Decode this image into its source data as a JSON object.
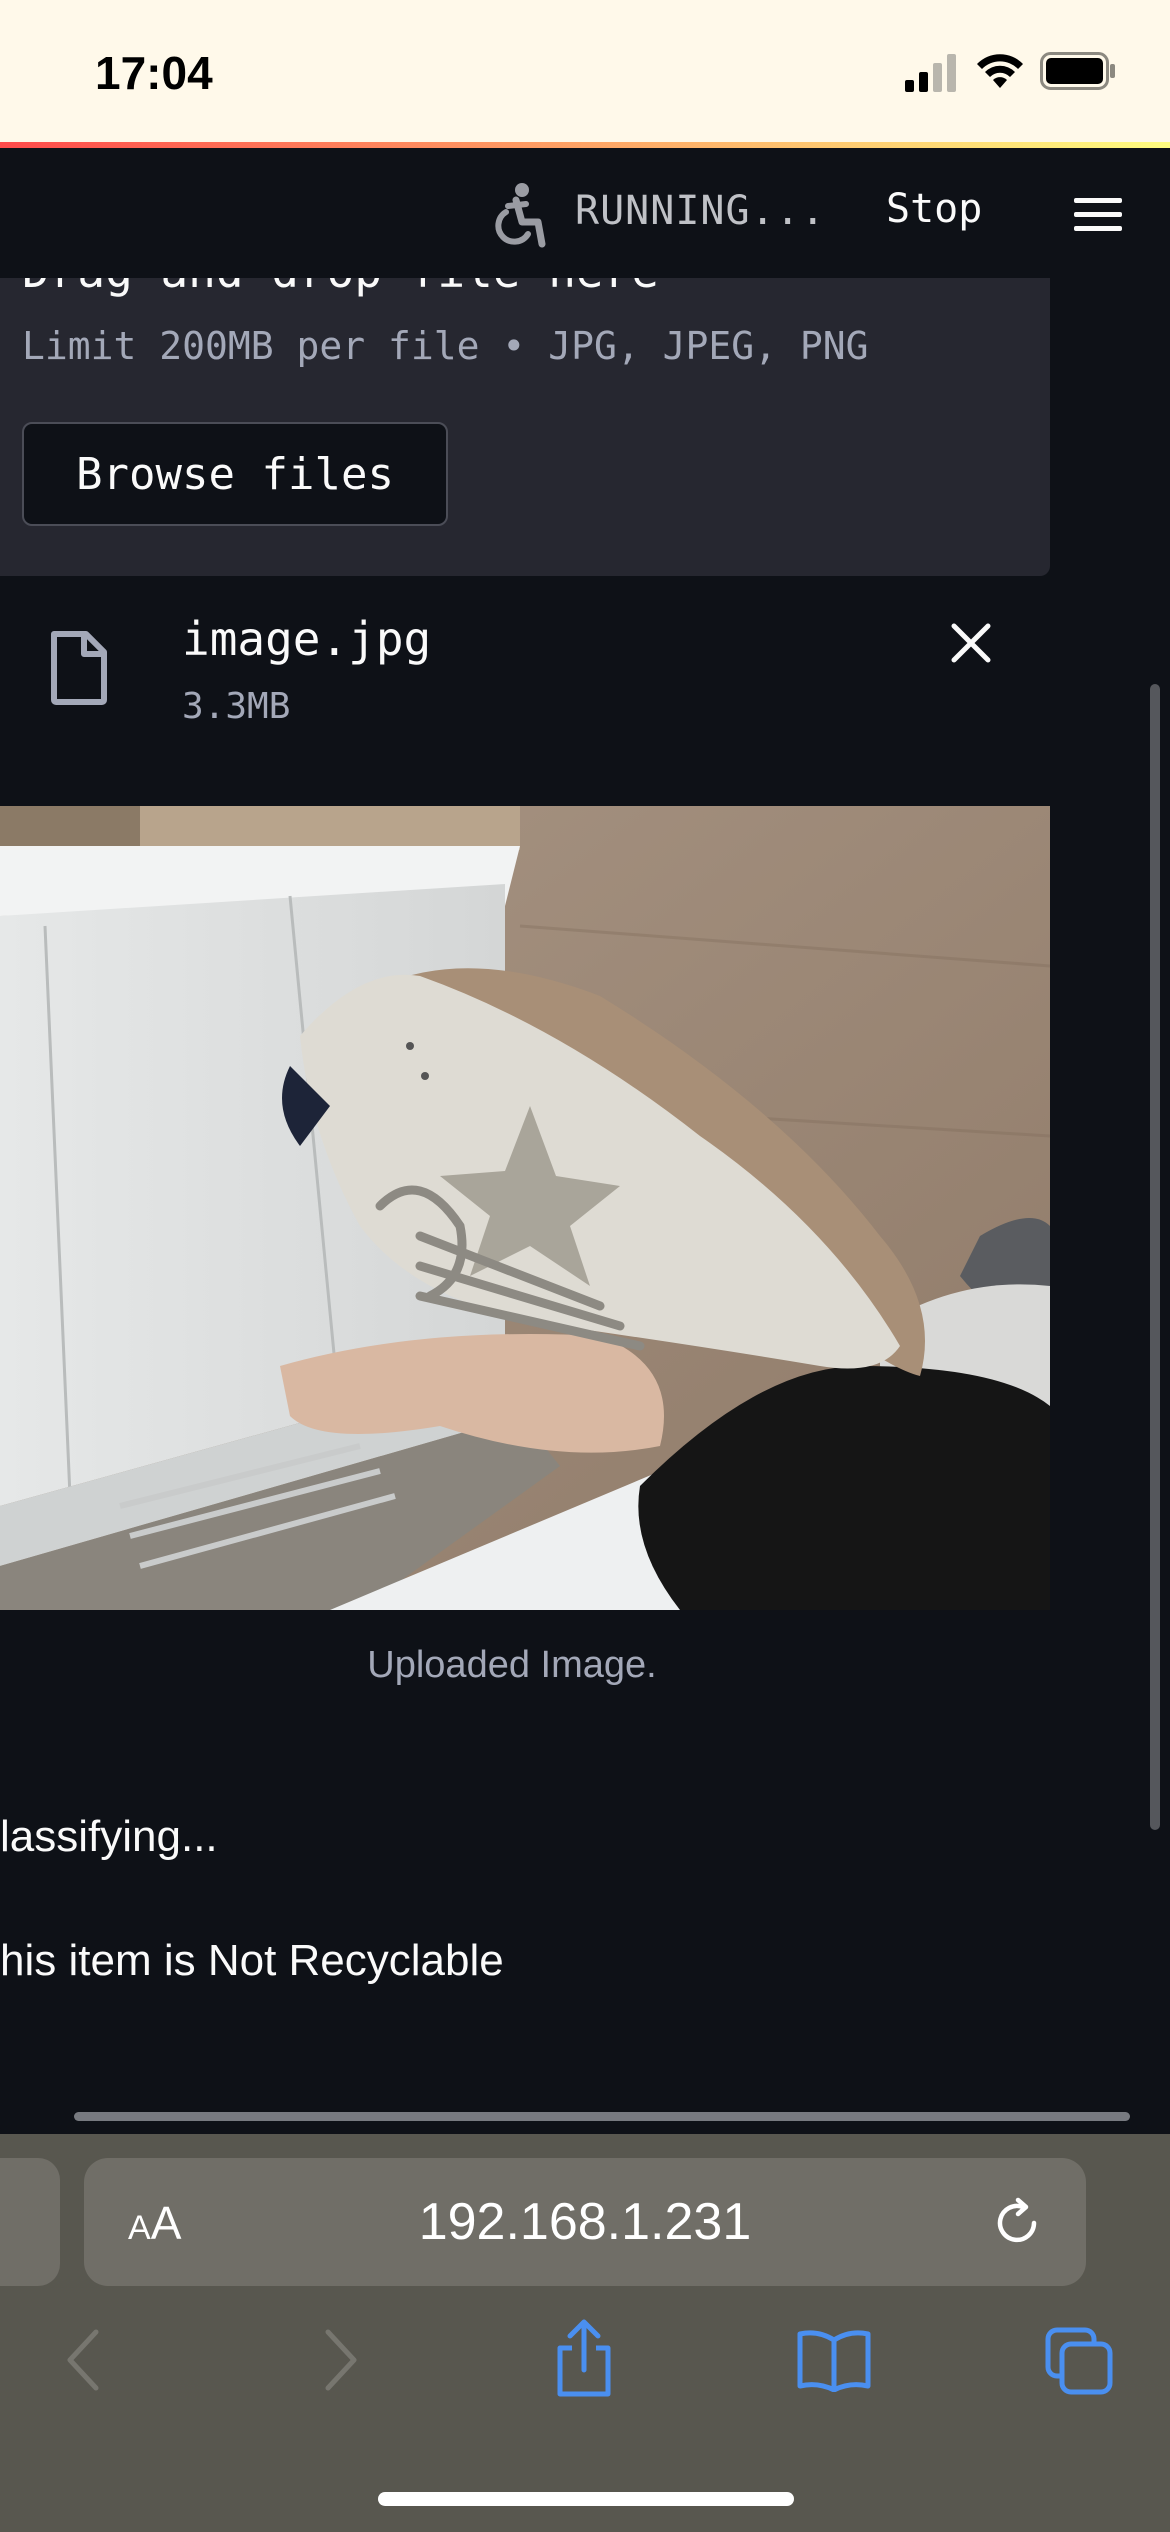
{
  "status_bar": {
    "time": "17:04",
    "icons": [
      "cellular-signal-icon",
      "wifi-icon",
      "battery-icon"
    ]
  },
  "app_header": {
    "status_text": "RUNNING...",
    "stop_label": "Stop",
    "icons": [
      "running-man-icon",
      "hamburger-menu-icon"
    ]
  },
  "file_uploader": {
    "dropzone_title": "Drag and drop file here",
    "limit_text": "Limit 200MB per file • JPG, JPEG, PNG",
    "browse_label": "Browse files",
    "uploaded_file": {
      "name": "image.jpg",
      "size": "3.3MB"
    }
  },
  "image": {
    "caption": "Uploaded Image."
  },
  "results": {
    "classifying": "lassifying...",
    "result": "his item is Not Recyclable"
  },
  "safari": {
    "reader_small": "A",
    "reader_big": "A",
    "url": "192.168.1.231",
    "icons": [
      "back-icon",
      "forward-icon",
      "share-icon",
      "bookmarks-icon",
      "tabs-icon",
      "reload-icon"
    ]
  },
  "colors": {
    "app_background": "#0e1117",
    "dropzone_background": "#262730",
    "status_bar_background": "#fff9ea",
    "safari_toolbar": "#58574f",
    "safari_accent": "#4a8ff0"
  }
}
